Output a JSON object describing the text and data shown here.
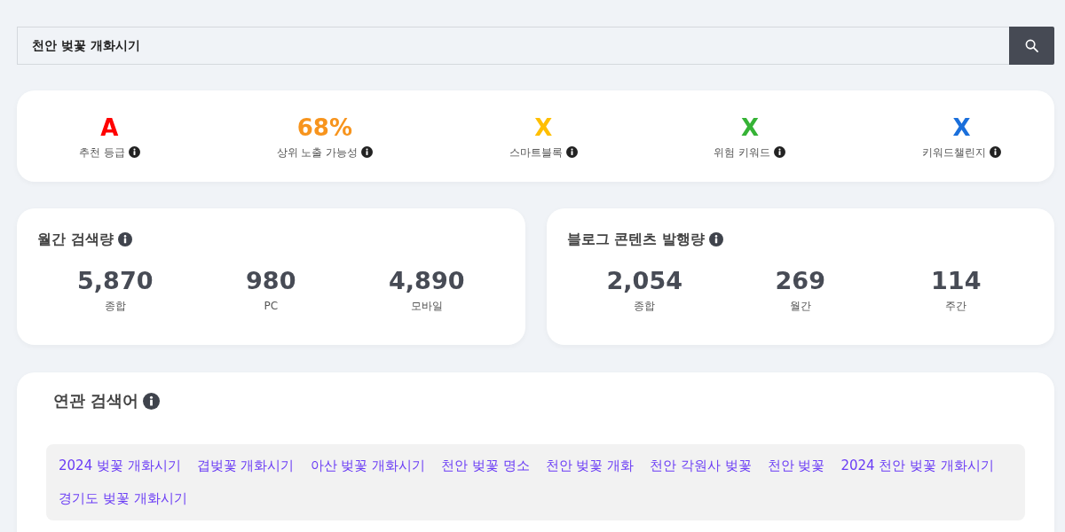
{
  "search": {
    "value": "천안 벚꽃 개화시기"
  },
  "summary": [
    {
      "value": "A",
      "label": "추천 등급",
      "color": "#ff0000"
    },
    {
      "value": "68%",
      "label": "상위 노출 가능성",
      "color": "#f7941d"
    },
    {
      "value": "X",
      "label": "스마트블록",
      "color": "#ffbf00"
    },
    {
      "value": "X",
      "label": "위험 키워드",
      "color": "#36b336"
    },
    {
      "value": "X",
      "label": "키워드챌린지",
      "color": "#1a6fdb"
    }
  ],
  "stats": [
    {
      "title": "월간 검색량",
      "metrics": [
        {
          "value": "5,870",
          "label": "종합"
        },
        {
          "value": "980",
          "label": "PC"
        },
        {
          "value": "4,890",
          "label": "모바일"
        }
      ]
    },
    {
      "title": "블로그 콘텐츠 발행량",
      "metrics": [
        {
          "value": "2,054",
          "label": "종합"
        },
        {
          "value": "269",
          "label": "월간"
        },
        {
          "value": "114",
          "label": "주간"
        }
      ]
    }
  ],
  "related": {
    "title": "연관 검색어",
    "keywords": [
      "2024 벚꽃 개화시기",
      "겹벚꽃 개화시기",
      "아산 벚꽃 개화시기",
      "천안 벚꽃 명소",
      "천안 벚꽃 개화",
      "천안 각원사 벚꽃",
      "천안 벚꽃",
      "2024 천안 벚꽃 개화시기",
      "경기도 벚꽃 개화시기"
    ]
  }
}
